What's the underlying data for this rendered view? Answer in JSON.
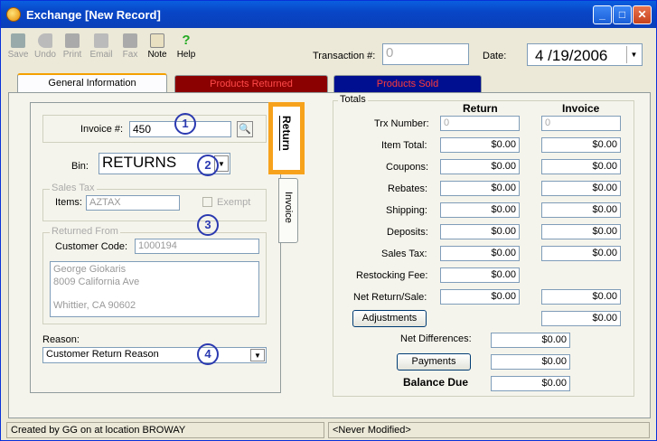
{
  "window": {
    "title": "Exchange [New Record]"
  },
  "toolbar": {
    "save": "Save",
    "undo": "Undo",
    "print": "Print",
    "email": "Email",
    "fax": "Fax",
    "note": "Note",
    "help": "Help"
  },
  "header": {
    "transaction_label": "Transaction #:",
    "transaction_value": "0",
    "date_label": "Date:",
    "date_value": "4 /19/2006"
  },
  "tabs": {
    "general": "General Information",
    "returned": "Products Returned",
    "sold": "Products Sold",
    "side_return": "Return",
    "side_invoice": "Invoice"
  },
  "form": {
    "invoice_label": "Invoice #:",
    "invoice_value": "450",
    "bin_label": "Bin:",
    "bin_value": "RETURNS",
    "sales_tax_group": "Sales Tax",
    "items_label": "Items:",
    "items_value": "AZTAX",
    "exempt_label": "Exempt",
    "returned_from_group": "Returned From",
    "customer_code_label": "Customer Code:",
    "customer_code_value": "1000194",
    "address_line1": "George Giokaris",
    "address_line2": "8009 California Ave",
    "address_line3": "Whittier, CA 90602",
    "reason_label": "Reason:",
    "reason_value": "Customer Return Reason"
  },
  "annotations": [
    "1",
    "2",
    "3",
    "4"
  ],
  "totals": {
    "group_label": "Totals",
    "col_return": "Return",
    "col_invoice": "Invoice",
    "trx_number_label": "Trx Number:",
    "trx_return": "0",
    "trx_invoice": "0",
    "item_total_label": "Item Total:",
    "coupons_label": "Coupons:",
    "rebates_label": "Rebates:",
    "shipping_label": "Shipping:",
    "deposits_label": "Deposits:",
    "sales_tax_label": "Sales Tax:",
    "restocking_label": "Restocking Fee:",
    "net_label": "Net Return/Sale:",
    "adjustments_button": "Adjustments",
    "net_differences_label": "Net Differences:",
    "payments_button": "Payments",
    "balance_due_label": "Balance Due",
    "zero": "$0.00"
  },
  "status": {
    "created": "Created by GG on  at location BROWAY",
    "modified": "<Never Modified>"
  }
}
